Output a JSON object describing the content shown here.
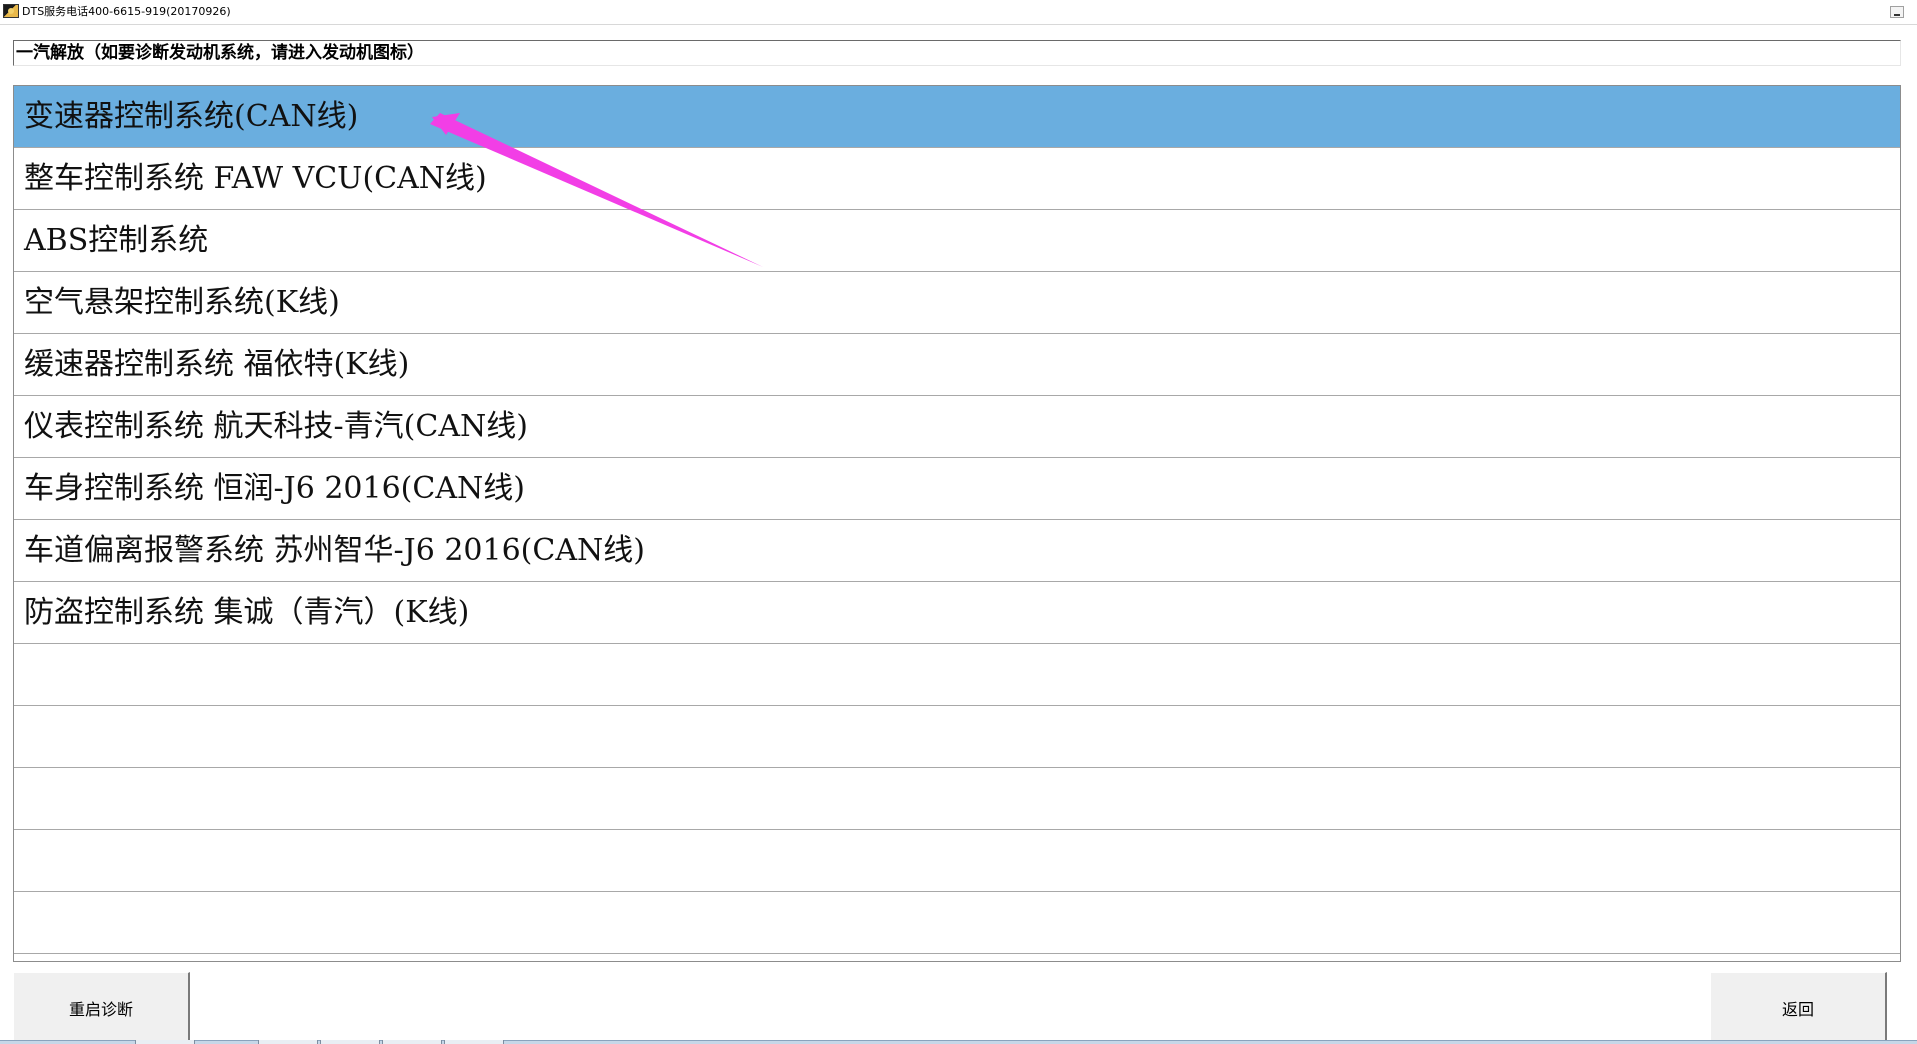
{
  "window": {
    "title": "DTS服务电话400-6615-919(20170926)"
  },
  "header": {
    "text": "一汽解放（如要诊断发动机系统，请进入发动机图标）"
  },
  "system_list": {
    "selected_index": 0,
    "items": [
      {
        "label": "变速器控制系统(CAN线)"
      },
      {
        "label": "整车控制系统 FAW VCU(CAN线)"
      },
      {
        "label": "ABS控制系统"
      },
      {
        "label": "空气悬架控制系统(K线)"
      },
      {
        "label": "缓速器控制系统 福依特(K线)"
      },
      {
        "label": "仪表控制系统 航天科技-青汽(CAN线)"
      },
      {
        "label": "车身控制系统 恒润-J6 2016(CAN线)"
      },
      {
        "label": "车道偏离报警系统 苏州智华-J6 2016(CAN线)"
      },
      {
        "label": "防盗控制系统 集诚（青汽）(K线)"
      },
      {
        "label": ""
      },
      {
        "label": ""
      },
      {
        "label": ""
      },
      {
        "label": ""
      },
      {
        "label": ""
      }
    ]
  },
  "footer": {
    "restart_label": "重启诊断",
    "back_label": "返回"
  },
  "colors": {
    "selected_row": "#6aaedf",
    "annotation_arrow": "#f23ee6"
  },
  "icons": {
    "app": "app-icon",
    "minimize": "minimize-icon",
    "annotation": "arrow-annotation-icon"
  }
}
